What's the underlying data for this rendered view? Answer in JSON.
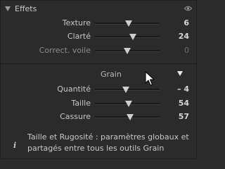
{
  "section": {
    "title": "Effets"
  },
  "effets_sliders": [
    {
      "label": "Texture",
      "value": "6",
      "fraction": 0.52
    },
    {
      "label": "Clarté",
      "value": "24",
      "fraction": 0.59
    },
    {
      "label": "Correct. voile",
      "value": "0",
      "fraction": 0.5
    }
  ],
  "grain": {
    "title": "Grain",
    "sliders": [
      {
        "label": "Quantité",
        "value": "– 4",
        "fraction": 0.48
      },
      {
        "label": "Taille",
        "value": "54",
        "fraction": 0.52
      },
      {
        "label": "Cassure",
        "value": "57",
        "fraction": 0.54
      }
    ]
  },
  "info": {
    "text": "Taille et Rugosité : paramètres globaux et partagés entre tous les outils Grain"
  },
  "colors": {
    "panel_bg": "#2b2b2b",
    "text": "#c7c7c7",
    "value_bright": "#d7d7d7",
    "value_dim": "#6f6f6f"
  }
}
